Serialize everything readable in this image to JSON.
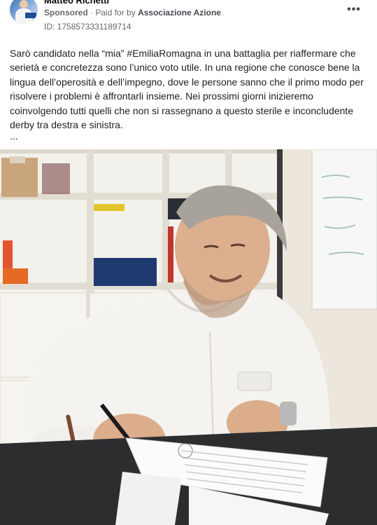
{
  "post": {
    "author": "Matteo Richetti",
    "sponsored_label": "Sponsored",
    "paid_prefix": "· Paid for by",
    "payer": "Associazione Azione",
    "ad_id": "ID: 1758573331189714",
    "more_icon": "more-options-icon",
    "text": "Sarò candidato nella “mia” #EmiliaRomagna in una battaglia per riaffermare che serietà e concretezza sono l’unico voto utile. In una regione che conosce bene la lingua dell’operosità e dell’impegno, dove le persone sanno che il primo modo per risolvere i problemi è affrontarli insieme. Nei prossimi giorni inizieremo coinvolgendo tutti quelli che non si rassegnano a questo sterile e inconcludente derby tra destra e sinistra.",
    "ellipsis": "..."
  },
  "colors": {
    "text_primary": "#1c1e21",
    "text_secondary": "#65676b",
    "background": "#ffffff"
  }
}
